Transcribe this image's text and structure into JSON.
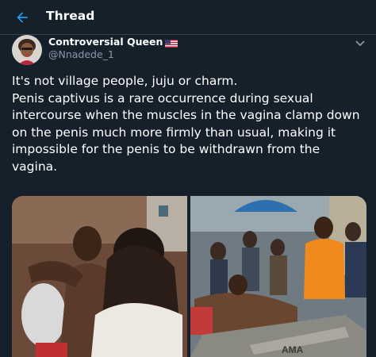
{
  "header": {
    "title": "Thread",
    "back_icon": "arrow-left-icon",
    "accent": "#1da1f2"
  },
  "tweet": {
    "author_name": "Controversial Queen",
    "author_flag": "us-flag-icon",
    "handle": "@Nnadede_1",
    "menu_icon": "chevron-down-icon",
    "lines": [
      "It's not village people, juju or charm.",
      "Penis captivus is a rare occurrence during sexual intercourse when the muscles in the vagina clamp down on the penis much more firmly than usual, making it impossible for the penis to be withdrawn from the vagina."
    ],
    "media_label": "AMA"
  },
  "colors": {
    "background": "#15202b",
    "text": "#ffffff",
    "secondary_text": "#8899a6",
    "border": "#38444d"
  }
}
